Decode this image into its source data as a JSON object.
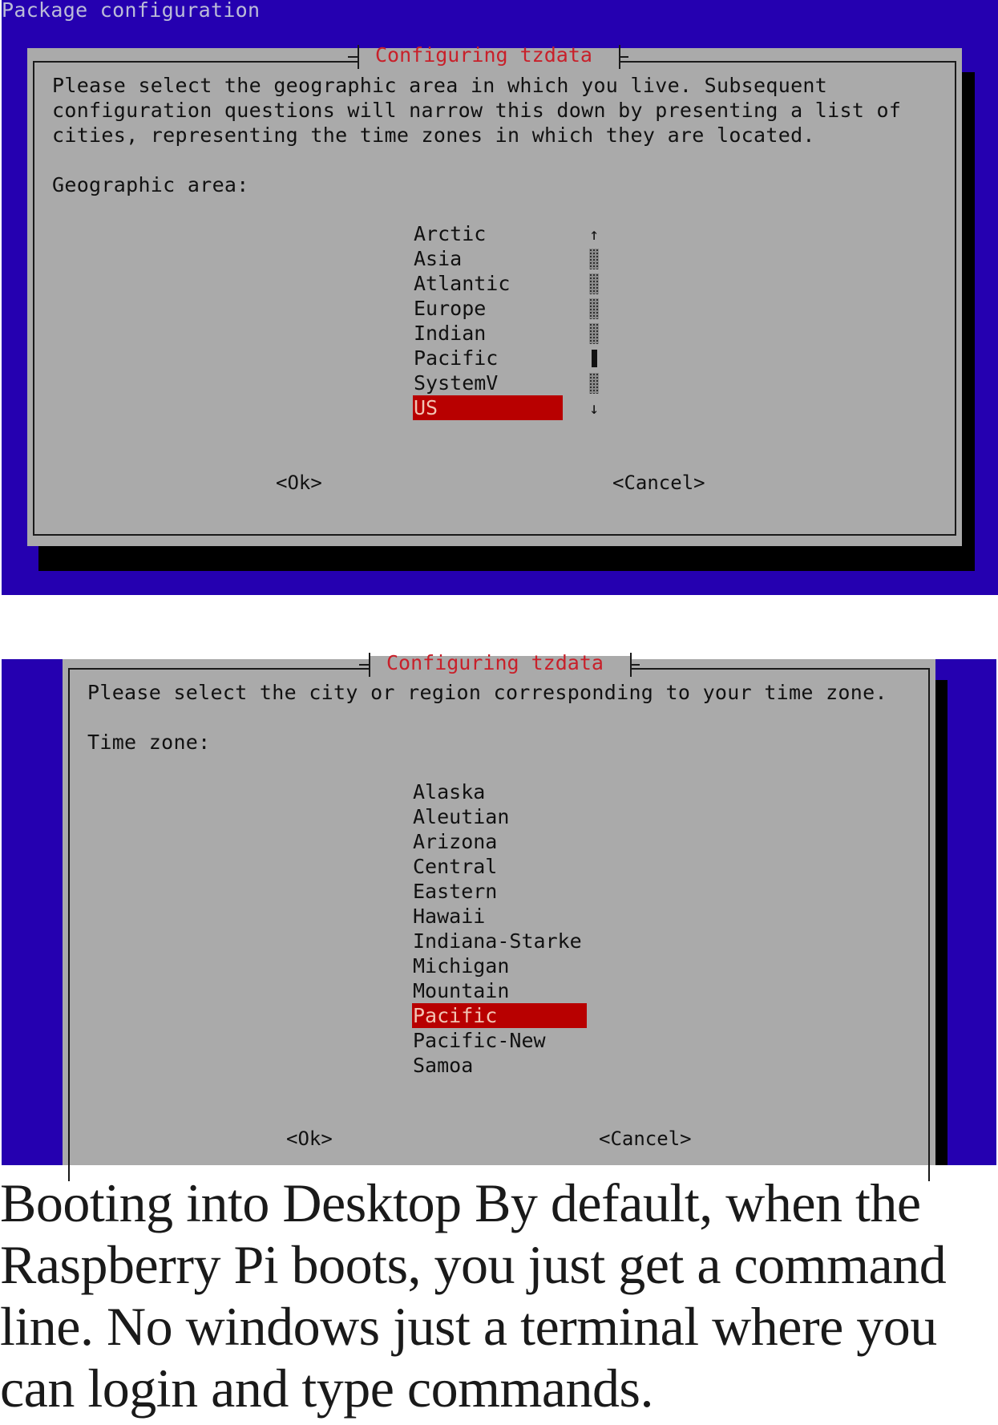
{
  "screen1": {
    "header": "Package configuration",
    "dialog_title": "Configuring tzdata",
    "body_lines": [
      "Please select the geographic area in which you live. Subsequent",
      "configuration questions will narrow this down by presenting a list of",
      "cities, representing the time zones in which they are located."
    ],
    "prompt": "Geographic area:",
    "list_items": [
      "Arctic",
      "Asia",
      "Atlantic",
      "Europe",
      "Indian",
      "Pacific",
      "SystemV",
      "US"
    ],
    "selected_item": "US",
    "scrollbar": {
      "up_arrow": "↑",
      "down_arrow": "↓",
      "track_cells": 6,
      "thumb_index": 4
    },
    "ok_label": "<Ok>",
    "cancel_label": "<Cancel>"
  },
  "screen2": {
    "dialog_title": "Configuring tzdata",
    "body_lines": [
      "Please select the city or region corresponding to your time zone."
    ],
    "prompt": "Time zone:",
    "list_items": [
      "Alaska",
      "Aleutian",
      "Arizona",
      "Central",
      "Eastern",
      "Hawaii",
      "Indiana-Starke",
      "Michigan",
      "Mountain",
      "Pacific",
      "Pacific-New",
      "Samoa"
    ],
    "selected_item": "Pacific",
    "ok_label": "<Ok>",
    "cancel_label": "<Cancel>"
  },
  "paragraph": "Booting into Desktop By default, when the Raspberry Pi boots, you just get a command line. No windows just a terminal where you can login and type commands.",
  "colors": {
    "background_blue": "#2500b0",
    "dialog_gray": "#aaaaaa",
    "title_red": "#c8202a",
    "selection_red": "#b80000",
    "selection_text": "#f2c4b4"
  }
}
